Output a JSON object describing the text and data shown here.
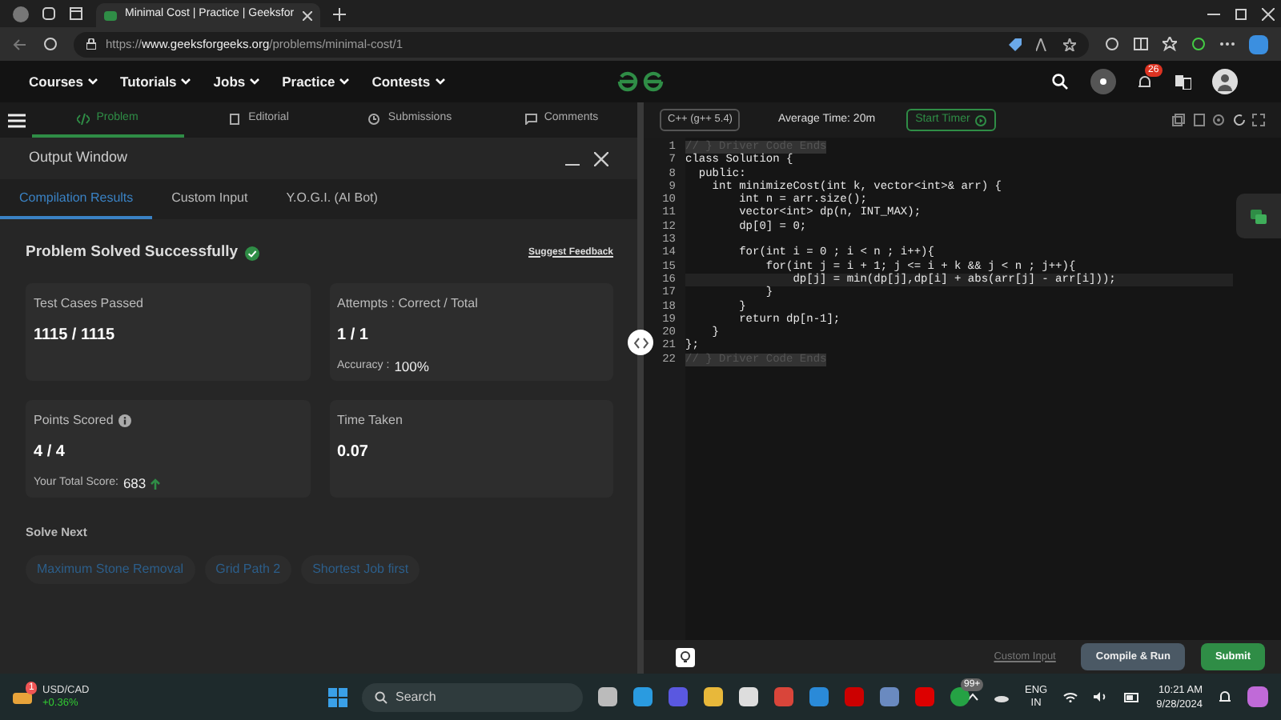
{
  "browser": {
    "tab_title": "Minimal Cost | Practice | Geeksfor",
    "url": "https://**www.geeksforgeeks.org**/problems/minimal-cost/1"
  },
  "site_nav": {
    "menus": [
      "Courses",
      "Tutorials",
      "Jobs",
      "Practice",
      "Contests"
    ],
    "notification_count": "26"
  },
  "problem_tabs": [
    {
      "label": "Problem",
      "selected": true
    },
    {
      "label": "Editorial",
      "selected": false
    },
    {
      "label": "Submissions",
      "selected": false
    },
    {
      "label": "Comments",
      "selected": false
    }
  ],
  "output_window": {
    "title": "Output Window",
    "tabs": [
      {
        "label": "Compilation Results",
        "selected": true
      },
      {
        "label": "Custom Input",
        "selected": false
      },
      {
        "label": "Y.O.G.I. (AI Bot)",
        "selected": false
      }
    ],
    "status": "Problem Solved Successfully",
    "feedback_link": "Suggest Feedback",
    "stats": [
      {
        "label": "Test Cases Passed",
        "value": "1115 / 1115",
        "info": false
      },
      {
        "label": "Attempts : Correct / Total",
        "value": "1 / 1",
        "note_label": "Accuracy :",
        "note_value": "100%",
        "info": false,
        "rising": false
      },
      {
        "label": "Points Scored",
        "value": "4 / 4",
        "note_label": "Your Total Score:",
        "note_value": "683",
        "info": true,
        "rising": true
      },
      {
        "label": "Time Taken",
        "value": "0.07",
        "info": false
      }
    ],
    "solve_next": {
      "title": "Solve Next",
      "items": [
        "Maximum Stone Removal",
        "Grid Path 2",
        "Shortest Job first"
      ]
    }
  },
  "editor": {
    "language": "C++ (g++ 5.4)",
    "average_time": "Average Time: 20m",
    "timer_button": "Start Timer",
    "lines": [
      {
        "number": "1",
        "text": "// } Driver Code Ends",
        "kind": "fold",
        "current": false
      },
      {
        "number": "7",
        "text": "class Solution {",
        "kind": "code",
        "current": false
      },
      {
        "number": "8",
        "text": "  public:",
        "kind": "code",
        "current": false
      },
      {
        "number": "9",
        "text": "    int minimizeCost(int k, vector<int>& arr) {",
        "kind": "code",
        "current": false
      },
      {
        "number": "10",
        "text": "        int n = arr.size();",
        "kind": "code",
        "current": false
      },
      {
        "number": "11",
        "text": "        vector<int> dp(n, INT_MAX);",
        "kind": "code",
        "current": false
      },
      {
        "number": "12",
        "text": "        dp[0] = 0;",
        "kind": "code",
        "current": false
      },
      {
        "number": "13",
        "kind": "code",
        "current": false
      },
      {
        "number": "14",
        "text": "        for(int i = 0 ; i < n ; i++){",
        "kind": "code",
        "current": false
      },
      {
        "number": "15",
        "text": "            for(int j = i + 1; j <= i + k && j < n ; j++){",
        "kind": "code",
        "current": false
      },
      {
        "number": "16",
        "text": "                dp[j] = min(dp[j],dp[i] + abs(arr[j] - arr[i]));",
        "kind": "code",
        "current": true
      },
      {
        "number": "17",
        "text": "            }",
        "kind": "code",
        "current": false
      },
      {
        "number": "18",
        "text": "        }",
        "kind": "code",
        "current": false
      },
      {
        "number": "19",
        "text": "        return dp[n-1];",
        "kind": "code",
        "current": false
      },
      {
        "number": "20",
        "text": "    }",
        "kind": "code",
        "current": false
      },
      {
        "number": "21",
        "text": "};",
        "kind": "code",
        "current": false
      },
      {
        "number": "22",
        "text": "// } Driver Code Ends",
        "kind": "fold",
        "current": false
      }
    ],
    "custom_input": "Custom Input",
    "compile_button": "Compile & Run",
    "submit_button": "Submit"
  },
  "taskbar": {
    "widget_title": "USD/CAD",
    "widget_change": "+0.36%",
    "widget_badge": "1",
    "search": "Search",
    "chat_badge": "99+",
    "language": "ENG",
    "region": "IN",
    "time": "10:21 AM",
    "date": "9/28/2024"
  }
}
